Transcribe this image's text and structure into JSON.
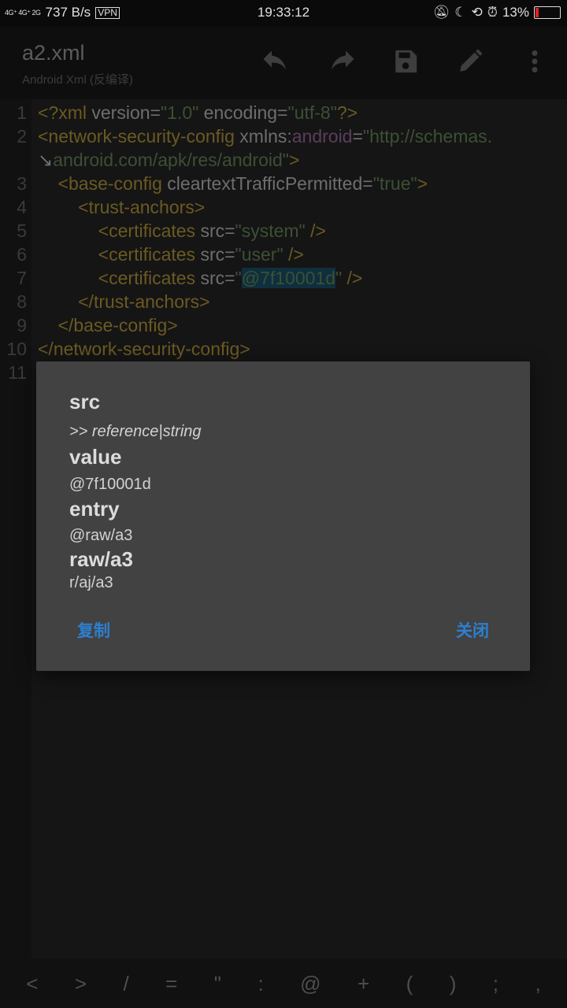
{
  "status": {
    "network": "4G⁺ 4G⁺ 2G",
    "speed": "737 B/s",
    "vpn": "VPN",
    "time": "19:33:12",
    "battery": "13%",
    "battery_level": 0.13
  },
  "appbar": {
    "title": "a2.xml",
    "subtitle": "Android Xml (反编译)"
  },
  "editor": {
    "rows": [
      {
        "num": "1",
        "segs": [
          {
            "t": "<?xml ",
            "c": "tag"
          },
          {
            "t": "version=",
            "c": "attr"
          },
          {
            "t": "\"1.0\"",
            "c": "val"
          },
          {
            "t": " encoding=",
            "c": "attr"
          },
          {
            "t": "\"utf-8\"",
            "c": "val"
          },
          {
            "t": "?>",
            "c": "tag"
          }
        ]
      },
      {
        "num": "2",
        "segs": [
          {
            "t": "<network-security-config ",
            "c": "tag"
          },
          {
            "t": "xmlns:",
            "c": "attr"
          },
          {
            "t": "android",
            "c": "ns"
          },
          {
            "t": "=",
            "c": "attr"
          },
          {
            "t": "\"http://schemas.",
            "c": "val"
          }
        ]
      },
      {
        "num": "",
        "segs": [
          {
            "t": "↘",
            "c": "plain"
          },
          {
            "t": "android.com/apk/res/android\"",
            "c": "val"
          },
          {
            "t": ">",
            "c": "tag"
          }
        ]
      },
      {
        "num": "3",
        "segs": [
          {
            "t": "    <base-config ",
            "c": "tag"
          },
          {
            "t": "cleartextTrafficPermitted=",
            "c": "attr"
          },
          {
            "t": "\"true\"",
            "c": "val"
          },
          {
            "t": ">",
            "c": "tag"
          }
        ]
      },
      {
        "num": "4",
        "segs": [
          {
            "t": "        <trust-anchors>",
            "c": "tag"
          }
        ]
      },
      {
        "num": "5",
        "segs": [
          {
            "t": "            <certificates ",
            "c": "tag"
          },
          {
            "t": "src=",
            "c": "attr"
          },
          {
            "t": "\"system\"",
            "c": "val"
          },
          {
            "t": " />",
            "c": "tag"
          }
        ]
      },
      {
        "num": "6",
        "segs": [
          {
            "t": "            <certificates ",
            "c": "tag"
          },
          {
            "t": "src=",
            "c": "attr"
          },
          {
            "t": "\"user\"",
            "c": "val"
          },
          {
            "t": " />",
            "c": "tag"
          }
        ]
      },
      {
        "num": "7",
        "segs": [
          {
            "t": "            <certificates ",
            "c": "tag"
          },
          {
            "t": "src=",
            "c": "attr"
          },
          {
            "t": "\"",
            "c": "val"
          },
          {
            "t": "@7f10001d",
            "c": "val sel"
          },
          {
            "t": "\"",
            "c": "val"
          },
          {
            "t": " />",
            "c": "tag"
          }
        ]
      },
      {
        "num": "8",
        "segs": [
          {
            "t": "        </trust-anchors>",
            "c": "tag"
          }
        ]
      },
      {
        "num": "9",
        "segs": [
          {
            "t": "    </base-config>",
            "c": "tag"
          }
        ]
      },
      {
        "num": "10",
        "segs": [
          {
            "t": "</network-security-config>",
            "c": "tag"
          }
        ]
      },
      {
        "num": "11",
        "segs": []
      }
    ]
  },
  "dialog": {
    "attr_name": "src",
    "attr_type": ">> reference|string",
    "value_label": "value",
    "value": "@7f10001d",
    "entry_label": "entry",
    "entry": "@raw/a3",
    "res_label": "raw/a3",
    "res_path": "r/aj/a3",
    "copy_label": "复制",
    "close_label": "关闭"
  },
  "symbols": [
    "<",
    ">",
    "/",
    "=",
    "\"",
    ":",
    "@",
    "+",
    "(",
    ")",
    ";",
    ","
  ]
}
